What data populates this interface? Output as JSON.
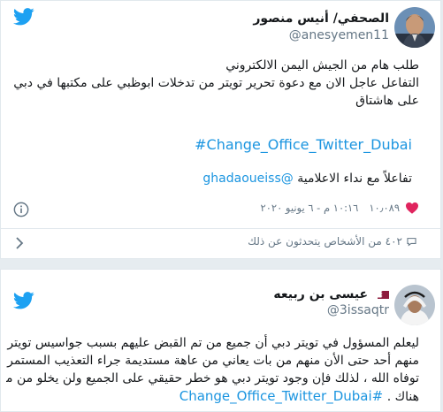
{
  "colors": {
    "twitter_blue": "#1da1f2",
    "link": "#1b95e0",
    "heart": "#e0245e"
  },
  "tweet1": {
    "name": "الصحفي/ أنيس منصور",
    "handle": "@anesyemen11",
    "lines": [
      "طلب هام من الجيش اليمن الالكتروني",
      "التفاعل عاجل الان مع دعوة تحرير تويتر من تدخلات  ابوظبي على مكتبها في دبي",
      "على هاشتاق"
    ],
    "hashtag": "#Change_Office_Twitter_Dubai",
    "mention_prefix": "تفاعلاً مع نداء الاعلامية",
    "mention": "@ghadaoueiss",
    "likes": "١٠٫٠٨٩",
    "timestamp": "١٠:١٦ م - ٦ يونيو ٢٠٢٠",
    "conversation": "٤٠٢ من الأشخاص يتحدثون عن ذلك",
    "icons": {
      "brand": "twitter-bird-icon",
      "like": "heart-icon",
      "info": "info-icon",
      "expand": "chevron-right-icon"
    }
  },
  "tweet2": {
    "name": "عيسى بن ربيعه",
    "handle": "@3issaqtr",
    "lines": [
      "ليعلم المسؤول في تويتر دبي أن جميع من تم القبض عليهم بسبب جواسيس تويتر لم يخرج",
      "منهم أحد حتى الأن منهم من بات يعاني من عاهة مستديمة جراء التعذيب المستمر ومنهم من",
      "توفاه الله ، لذلك فإن وجود تويتر دبي هو خطر حقيقي على الجميع ولن يخلو من متعاونين"
    ],
    "last_line_prefix": "هناك .",
    "hashtag": "#Change_Office_Twitter_Dubai",
    "icons": {
      "brand": "twitter-bird-icon",
      "flag": "qatar-flag-icon"
    }
  }
}
